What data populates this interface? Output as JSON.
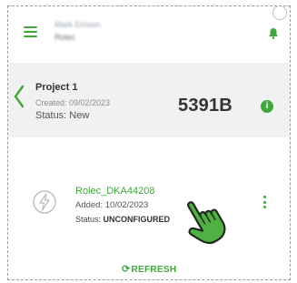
{
  "header": {
    "user_name": "Mark Emson",
    "company": "Rolec"
  },
  "project": {
    "title": "Project 1",
    "created": "Created: 09/02/2023",
    "status": "Status: New",
    "id": "5391B"
  },
  "device": {
    "name": "Rolec_DKA44208",
    "added": "Added: 10/02/2023",
    "status_label": "Status: ",
    "status_value": "UNCONFIGURED"
  },
  "actions": {
    "refresh_label": "REFRESH"
  },
  "colors": {
    "accent": "#41a63d",
    "panel": "#f0f1f1"
  },
  "icons": [
    "menu-icon",
    "bell-icon",
    "chevron-left-icon",
    "info-icon",
    "charger-bolt-icon",
    "more-vert-icon",
    "refresh-icon",
    "pointer-hand-icon"
  ]
}
